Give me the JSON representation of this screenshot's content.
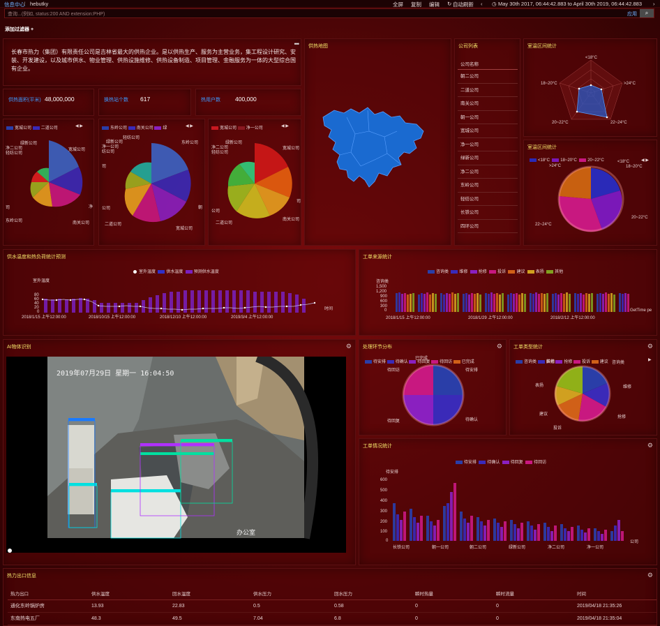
{
  "topbar": {
    "breadcrumb_root": "信息中心",
    "breadcrumb_sep": "/",
    "breadcrumb_current": "hebutky",
    "fullscreen": "全屏",
    "copy": "复制",
    "edit": "编辑",
    "auto_refresh": "自动刷新",
    "time_range": "May 30th 2017, 06:44:42.883 to April 30th 2019, 06:44:42.883"
  },
  "search": {
    "placeholder": "查询...(例如, status:200 AND extension:PHP)",
    "apply": "应用"
  },
  "add_filter": "添加过滤器 +",
  "intro": {
    "text": "长春市热力（集团）有限责任公司是吉林省最大的供热企业。是以供热生产、服务为主营业务，集工程设计研究、安装、开发建设，以及城市供水、物业管理、供热设施维修、供热设备制造、项目管理、金融服务为一体的大型综合国有企业。"
  },
  "kpis": [
    {
      "label": "供热面积(平米)",
      "value": "48,000,000"
    },
    {
      "label": "换热站个数",
      "value": "617"
    },
    {
      "label": "热用户数",
      "value": "400,000"
    }
  ],
  "pies": [
    {
      "legend": [
        "宽城公司",
        "二道公司"
      ],
      "labels": [
        "宽城公司",
        "绿新公司",
        "净二公司",
        "轻纺公司",
        "司",
        "东岭公司",
        "南关公司",
        "净"
      ]
    },
    {
      "legend": [
        "东岭公司",
        "南关公司",
        "绿"
      ],
      "labels": [
        "轻纺公司",
        "绿新公司",
        "净一公司",
        "纺公司",
        "司",
        "东岭公司",
        "公司",
        "二道公司",
        "宽城公司",
        "朝"
      ]
    },
    {
      "legend": [
        "宽城公司",
        "净一公司"
      ],
      "labels": [
        "宽城公司",
        "绿新公司",
        "净二公司",
        "轻纺公司",
        "公司",
        "二道公司",
        "南关公司",
        "司"
      ]
    }
  ],
  "map": {
    "title": "供热地图"
  },
  "company": {
    "title": "公司列表",
    "header": "公司名称",
    "items": [
      "朝二公司",
      "二道公司",
      "南关公司",
      "朝一公司",
      "宽城公司",
      "净一公司",
      "绿新公司",
      "净二公司",
      "东岭公司",
      "轻纺公司",
      "长铁公司",
      "四环公司"
    ]
  },
  "radar": {
    "title": "室温区间统计",
    "labels": [
      "<18°C",
      "18~20°C",
      ">24°C",
      "20~22°C",
      "22~24°C"
    ]
  },
  "rose": {
    "title": "室温区间统计",
    "legend": [
      "<18°C",
      "18~20°C",
      "20~22°C"
    ],
    "labels": [
      "<18°C",
      "18~20°C",
      ">24°C",
      "22~24°C",
      "20~22°C"
    ],
    "colors": [
      "#2a2ab8",
      "#7a18b8",
      "#c81880",
      "#c86010"
    ]
  },
  "forecast": {
    "title": "供水温度和热负荷统计预测",
    "legend": [
      "室外温度",
      "供水温度",
      "预测供水温度"
    ],
    "ylabel": "室外温度",
    "yticks": [
      "80",
      "60",
      "40",
      "20",
      "0"
    ],
    "xticks": [
      "2018/1/15 上午12:00:00",
      "2018/10/15 上午12:00:00",
      "2018/12/10 上午12:00:00",
      "2019/3/4 上午12:00:00"
    ],
    "xlabel": "时间"
  },
  "tickets": {
    "title": "工单来源统计",
    "legend": [
      "咨询类",
      "维修",
      "抢修",
      "投诉",
      "建议",
      "表扬",
      "其他"
    ],
    "ylabel": "咨询类",
    "yticks": [
      "1,500",
      "1,200",
      "900",
      "600",
      "300",
      "0"
    ],
    "xticks": [
      "2018/1/15 上午12:00:00",
      "2018/1/29 上午12:00:00",
      "2018/2/12 上午12:00:00"
    ],
    "xlabel": "GetTime pe"
  },
  "ai": {
    "title": "AI物体识别",
    "overlay_time": "2019年07月29日 星期一 16:04:50",
    "overlay_place": "办公室"
  },
  "process": {
    "title": "处理环节分布",
    "legend": [
      "待安排",
      "待确认",
      "待回复",
      "待回访",
      "已完成"
    ],
    "labels": [
      "已完成",
      "待回访",
      "待安排",
      "待回复",
      "待确认"
    ]
  },
  "ttype": {
    "title": "工单类型统计",
    "legend": [
      "咨询类",
      "维修",
      "抢修",
      "投诉",
      "建议"
    ],
    "labels": [
      "其他",
      "表扬",
      "建议",
      "投诉",
      "抢修",
      "维修",
      "咨询类"
    ]
  },
  "status": {
    "title": "工单情况统计",
    "legend": [
      "待安排",
      "待确认",
      "待回复",
      "待回访"
    ],
    "ylabel": "待安排",
    "yticks": [
      "600",
      "500",
      "400",
      "300",
      "200",
      "100",
      "0"
    ],
    "xticks": [
      "长铁公司",
      "朝一公司",
      "朝二公司",
      "绿新公司",
      "净二公司",
      "净一公司"
    ],
    "xlabel": "公司"
  },
  "outlet": {
    "title": "热力出口信息",
    "headers": [
      "热力出口",
      "供水温度",
      "回水温度",
      "供水压力",
      "回水压力",
      "瞬时热量",
      "瞬时流量",
      "时间"
    ],
    "rows": [
      [
        "通化东岭锅炉房",
        "13.93",
        "22.83",
        "0.5",
        "0.58",
        "0",
        "0",
        "2019/04/18 21:35:26"
      ],
      [
        "东南热电五厂",
        "48.3",
        "49.5",
        "7.04",
        "6.8",
        "0",
        "0",
        "2019/04/18 21:35:04"
      ]
    ]
  }
}
